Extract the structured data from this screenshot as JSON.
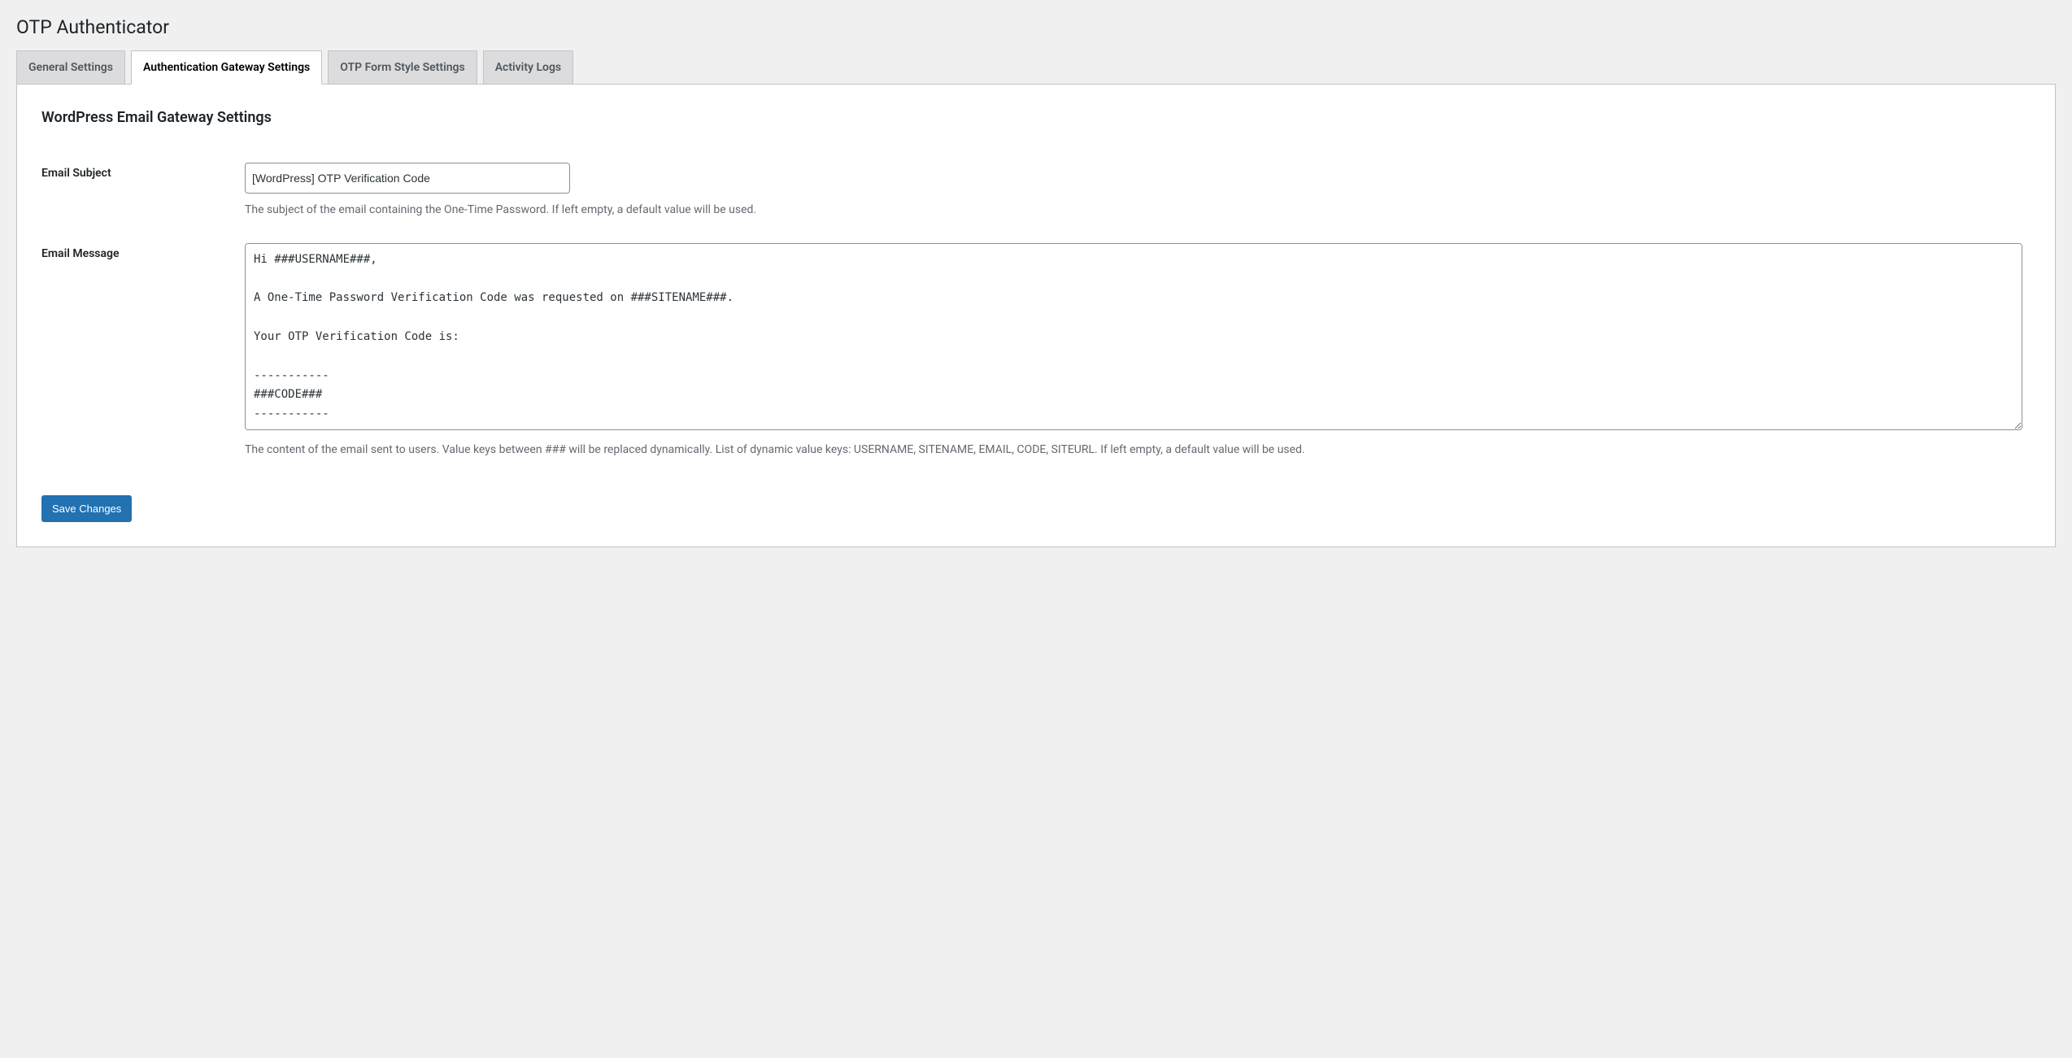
{
  "page_title": "OTP Authenticator",
  "tabs": [
    {
      "label": "General Settings",
      "active": false
    },
    {
      "label": "Authentication Gateway Settings",
      "active": true
    },
    {
      "label": "OTP Form Style Settings",
      "active": false
    },
    {
      "label": "Activity Logs",
      "active": false
    }
  ],
  "section_heading": "WordPress Email Gateway Settings",
  "fields": {
    "email_subject": {
      "label": "Email Subject",
      "value": "[WordPress] OTP Verification Code",
      "description": "The subject of the email containing the One-Time Password. If left empty, a default value will be used."
    },
    "email_message": {
      "label": "Email Message",
      "value": "Hi ###USERNAME###,\n\nA One-Time Password Verification Code was requested on ###SITENAME###.\n\nYour OTP Verification Code is:\n\n-----------\n###CODE###\n-----------",
      "description": "The content of the email sent to users. Value keys between ### will be replaced dynamically. List of dynamic value keys: USERNAME, SITENAME, EMAIL, CODE, SITEURL. If left empty, a default value will be used."
    }
  },
  "submit_label": "Save Changes"
}
